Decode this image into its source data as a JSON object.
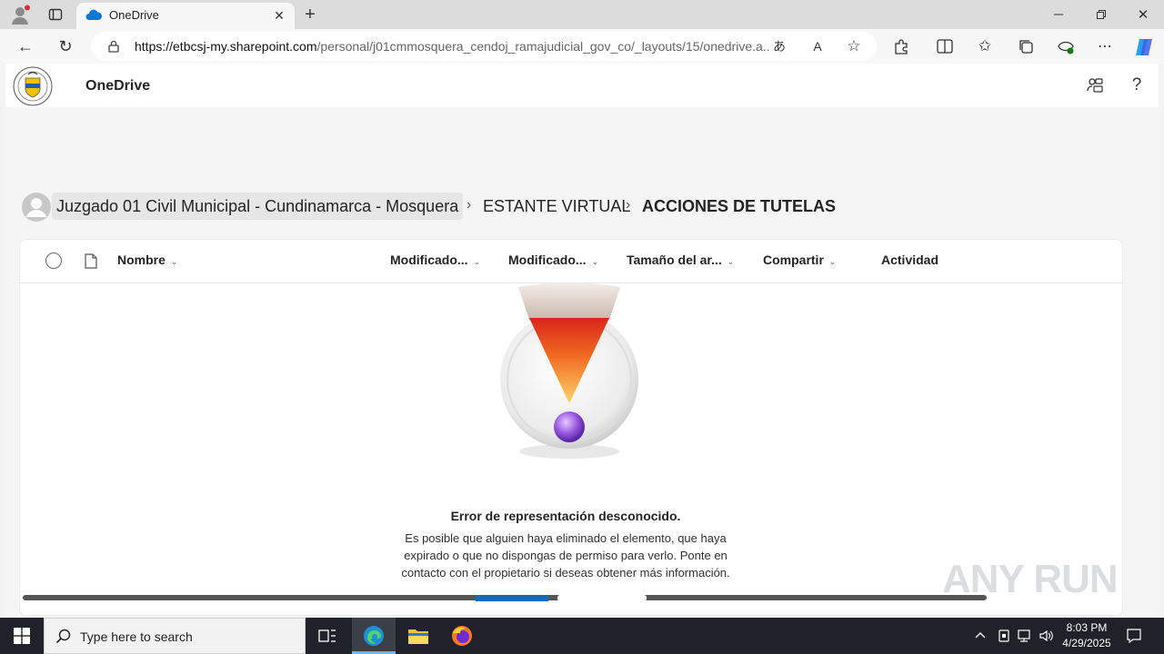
{
  "browser": {
    "tab_title": "OneDrive",
    "url_host": "https://etbcsj-my.sharepoint.com",
    "url_path": "/personal/j01cmmosquera_cendoj_ramajudicial_gov_co/_layouts/15/onedrive.a..."
  },
  "suitebar": {
    "app_name": "OneDrive"
  },
  "breadcrumb": {
    "items": [
      "Juzgado 01 Civil Municipal - Cundinamarca - Mosquera",
      "ESTANTE VIRTUAL",
      "ACCIONES DE TUTELAS"
    ]
  },
  "columns": {
    "name": "Nombre",
    "modified": "Modificado...",
    "modified_by": "Modificado...",
    "size": "Tamaño del ar...",
    "share": "Compartir",
    "activity": "Actividad"
  },
  "error": {
    "title": "Error de representación desconocido.",
    "line1": "Es posible que alguien haya eliminado el elemento, que haya",
    "line2": "expirado o que no dispongas de permiso para verlo. Ponte en",
    "line3": "contacto con el propietario si deseas obtener más información."
  },
  "watermark": "ANY RUN",
  "taskbar": {
    "search_placeholder": "Type here to search",
    "time": "8:03 PM",
    "date": "4/29/2025"
  },
  "colors": {
    "accent": "#0f6cbd",
    "taskbar": "#1f2228"
  }
}
